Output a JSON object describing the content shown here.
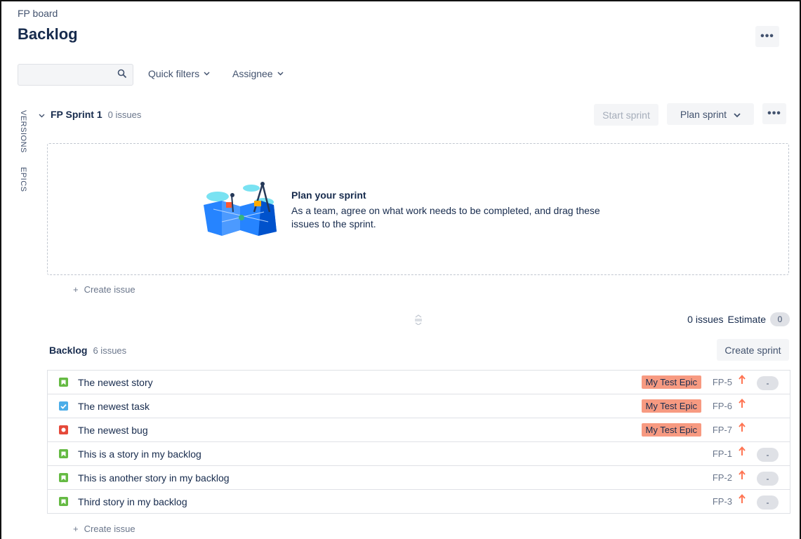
{
  "header": {
    "breadcrumb": "FP board",
    "title": "Backlog",
    "more_label": "•••"
  },
  "toolbar": {
    "search_placeholder": "",
    "quick_filters_label": "Quick filters",
    "assignee_label": "Assignee"
  },
  "side_tabs": {
    "versions": "VERSIONS",
    "epics": "EPICS"
  },
  "sprint": {
    "name": "FP Sprint 1",
    "issue_count": "0 issues",
    "start_label": "Start sprint",
    "plan_label": "Plan sprint",
    "more_label": "•••",
    "empty_title": "Plan your sprint",
    "empty_desc": "As a team, agree on what work needs to be completed, and drag these issues to the sprint.",
    "create_issue": "Create issue",
    "stats_issues": "0 issues",
    "stats_estimate_label": "Estimate",
    "stats_estimate_value": "0"
  },
  "backlog": {
    "title": "Backlog",
    "issue_count": "6 issues",
    "create_sprint_label": "Create sprint",
    "create_issue": "Create issue",
    "issues": [
      {
        "type": "story",
        "summary": "The newest story",
        "epic": "My Test Epic",
        "key": "FP-5",
        "estimate": "-"
      },
      {
        "type": "task",
        "summary": "The newest task",
        "epic": "My Test Epic",
        "key": "FP-6",
        "estimate": ""
      },
      {
        "type": "bug",
        "summary": "The newest bug",
        "epic": "My Test Epic",
        "key": "FP-7",
        "estimate": ""
      },
      {
        "type": "story",
        "summary": "This is a story in my backlog",
        "epic": "",
        "key": "FP-1",
        "estimate": "-"
      },
      {
        "type": "story",
        "summary": "This is another story in my backlog",
        "epic": "",
        "key": "FP-2",
        "estimate": "-"
      },
      {
        "type": "story",
        "summary": "Third story in my backlog",
        "epic": "",
        "key": "FP-3",
        "estimate": "-"
      }
    ]
  },
  "colors": {
    "story": "#65ba43",
    "task": "#4bade8",
    "bug": "#e5493a",
    "epic": "#f79a81",
    "priority_high": "#ff7452"
  }
}
